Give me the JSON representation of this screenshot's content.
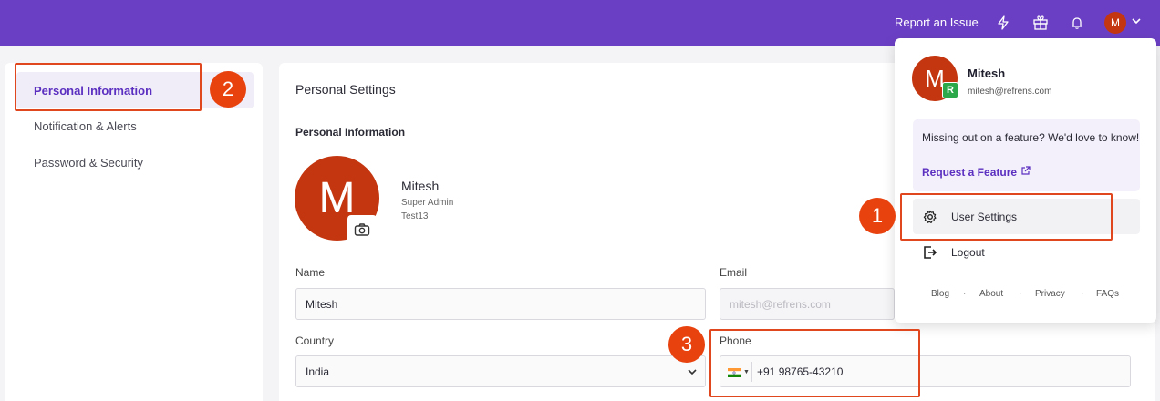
{
  "topbar": {
    "report_label": "Report an Issue",
    "avatar_initial": "M",
    "icons": [
      "lightning-icon",
      "gift-icon",
      "bell-icon",
      "chevron-down-icon"
    ]
  },
  "sidebar": {
    "items": [
      {
        "label": "Personal Information",
        "active": true
      },
      {
        "label": "Notification & Alerts",
        "active": false
      },
      {
        "label": "Password & Security",
        "active": false
      }
    ]
  },
  "main": {
    "page_title": "Personal Settings",
    "section_title": "Personal Information",
    "profile": {
      "avatar_initial": "M",
      "name": "Mitesh",
      "role": "Super Admin",
      "org": "Test13"
    },
    "fields": {
      "name_label": "Name",
      "name_value": "Mitesh",
      "email_label": "Email",
      "email_value": "mitesh@refrens.com",
      "country_label": "Country",
      "country_value": "India",
      "phone_label": "Phone",
      "phone_value": "+91 98765-43210"
    }
  },
  "dropdown": {
    "avatar_initial": "M",
    "badge": "R",
    "name": "Mitesh",
    "email": "mitesh@refrens.com",
    "feature_text": "Missing out on a feature? We'd love to know!",
    "feature_link": "Request a Feature",
    "settings_label": "User Settings",
    "logout_label": "Logout",
    "footer_links": [
      "Blog",
      "About",
      "Privacy",
      "FAQs"
    ],
    "separator": "·"
  },
  "annotations": [
    "1",
    "2",
    "3"
  ],
  "colors": {
    "brand": "#6b3fc4",
    "accent": "#5b2fc0",
    "avatar": "#c4360f",
    "highlight": "#e0471f",
    "r_badge": "#2aa84a"
  }
}
